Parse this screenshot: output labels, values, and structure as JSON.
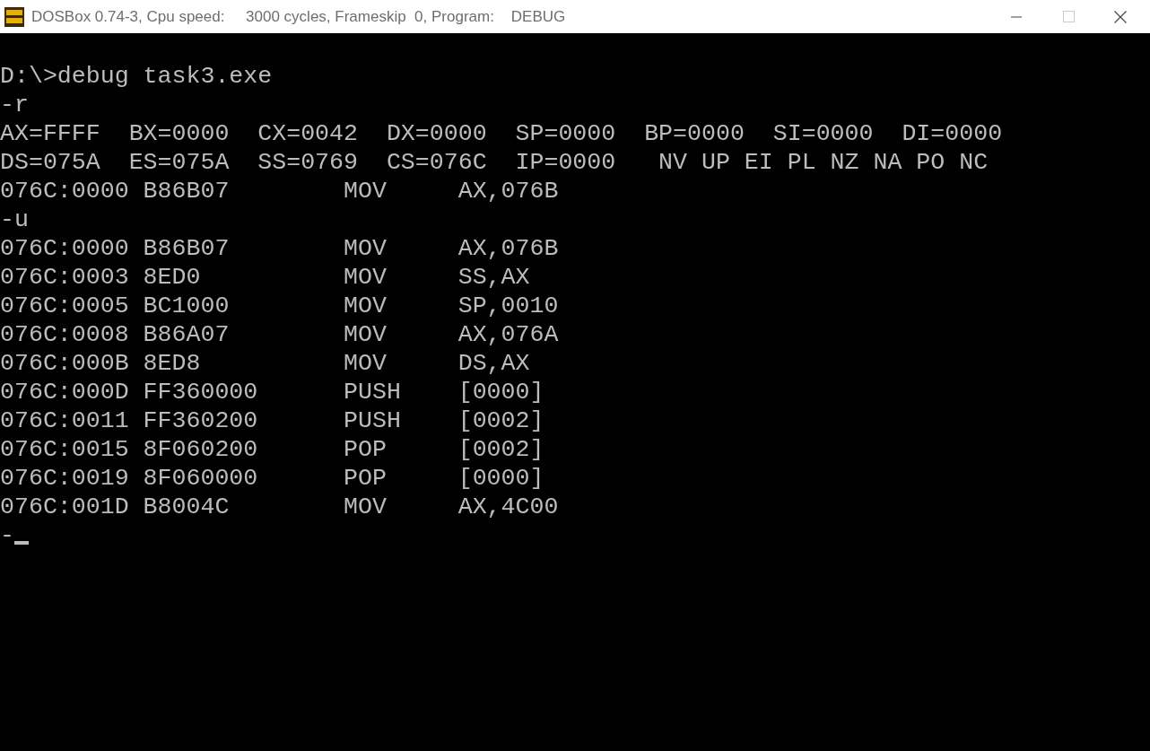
{
  "window": {
    "title": "DOSBox 0.74-3, Cpu speed:     3000 cycles, Frameskip  0, Program:    DEBUG"
  },
  "terminal": {
    "lines": [
      "D:\\>debug task3.exe",
      "-r",
      "AX=FFFF  BX=0000  CX=0042  DX=0000  SP=0000  BP=0000  SI=0000  DI=0000",
      "DS=075A  ES=075A  SS=0769  CS=076C  IP=0000   NV UP EI PL NZ NA PO NC",
      "076C:0000 B86B07        MOV     AX,076B",
      "-u",
      "076C:0000 B86B07        MOV     AX,076B",
      "076C:0003 8ED0          MOV     SS,AX",
      "076C:0005 BC1000        MOV     SP,0010",
      "076C:0008 B86A07        MOV     AX,076A",
      "076C:000B 8ED8          MOV     DS,AX",
      "076C:000D FF360000      PUSH    [0000]",
      "076C:0011 FF360200      PUSH    [0002]",
      "076C:0015 8F060200      POP     [0002]",
      "076C:0019 8F060000      POP     [0000]",
      "076C:001D B8004C        MOV     AX,4C00"
    ],
    "prompt": "-"
  }
}
